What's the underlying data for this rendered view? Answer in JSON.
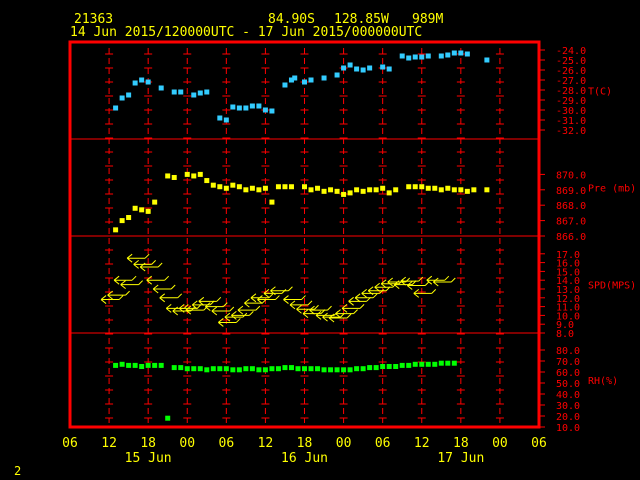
{
  "header": {
    "station": "21363",
    "lat": "84.90S",
    "lon": "128.85W",
    "elev": "989M",
    "time_range": "14 Jun 2015/120000UTC - 17 Jun 2015/000000UTC"
  },
  "page_number": "2",
  "colors": {
    "frame": "#ff0000",
    "text": "#ffff00",
    "temp": "#33ccff",
    "pressure": "#ffff00",
    "wind": "#ffff00",
    "rh": "#00ff00",
    "grid": "#ff0000"
  },
  "chart_data": {
    "type": "scatter",
    "x_ticks": [
      "06",
      "12",
      "18",
      "00",
      "06",
      "12",
      "18",
      "00",
      "06",
      "12",
      "18",
      "00",
      "06"
    ],
    "date_labels": [
      {
        "label": "15 Jun",
        "at_hour": 18
      },
      {
        "label": "16 Jun",
        "at_hour": 42
      },
      {
        "label": "17 Jun",
        "at_hour": 66
      }
    ],
    "xlim_hours_from_14jun_00utc": [
      6,
      78
    ],
    "panels": [
      {
        "name": "temperature",
        "label": "T(C)",
        "ylim": [
          -32,
          -24
        ],
        "tick_labels": [
          "-24.0",
          "-25.0",
          "-26.0",
          "-27.0",
          "-28.0",
          "-29.0",
          "-30.0",
          "-31.0",
          "-32.0"
        ],
        "tick_values": [
          -24,
          -25,
          -26,
          -27,
          -28,
          -29,
          -30,
          -31,
          -32
        ],
        "points": [
          [
            13,
            -29.8
          ],
          [
            14,
            -28.8
          ],
          [
            15,
            -28.5
          ],
          [
            16,
            -27.3
          ],
          [
            17,
            -27.0
          ],
          [
            18,
            -27.2
          ],
          [
            20,
            -27.8
          ],
          [
            22,
            -28.2
          ],
          [
            23,
            -28.2
          ],
          [
            25,
            -28.5
          ],
          [
            26,
            -28.3
          ],
          [
            27,
            -28.2
          ],
          [
            29,
            -30.8
          ],
          [
            30,
            -31.0
          ],
          [
            31,
            -29.7
          ],
          [
            32,
            -29.8
          ],
          [
            33,
            -29.8
          ],
          [
            34,
            -29.6
          ],
          [
            35,
            -29.6
          ],
          [
            36,
            -30.0
          ],
          [
            37,
            -30.1
          ],
          [
            39,
            -27.5
          ],
          [
            40,
            -27.0
          ],
          [
            40.5,
            -26.8
          ],
          [
            42,
            -27.2
          ],
          [
            43,
            -27.0
          ],
          [
            45,
            -26.8
          ],
          [
            47,
            -26.5
          ],
          [
            48,
            -25.8
          ],
          [
            49,
            -25.5
          ],
          [
            50,
            -25.9
          ],
          [
            51,
            -26.0
          ],
          [
            52,
            -25.8
          ],
          [
            54,
            -25.7
          ],
          [
            55,
            -25.9
          ],
          [
            57,
            -24.6
          ],
          [
            58,
            -24.8
          ],
          [
            59,
            -24.7
          ],
          [
            60,
            -24.7
          ],
          [
            61,
            -24.6
          ],
          [
            63,
            -24.6
          ],
          [
            64,
            -24.5
          ],
          [
            65,
            -24.3
          ],
          [
            66,
            -24.3
          ],
          [
            67,
            -24.4
          ],
          [
            70,
            -25.0
          ]
        ]
      },
      {
        "name": "pressure",
        "label": "Pre (mb)",
        "ylim": [
          866,
          871
        ],
        "tick_labels": [
          "866.0",
          "867.0",
          "868.0",
          "869.0",
          "870.0"
        ],
        "tick_values": [
          866,
          867,
          868,
          869,
          870
        ],
        "points": [
          [
            13,
            866.4
          ],
          [
            14,
            867.0
          ],
          [
            15,
            867.2
          ],
          [
            16,
            867.8
          ],
          [
            17,
            867.7
          ],
          [
            18,
            867.6
          ],
          [
            19,
            868.2
          ],
          [
            21,
            869.9
          ],
          [
            22,
            869.8
          ],
          [
            24,
            870.0
          ],
          [
            25,
            869.9
          ],
          [
            26,
            870.0
          ],
          [
            27,
            869.6
          ],
          [
            28,
            869.3
          ],
          [
            29,
            869.2
          ],
          [
            30,
            869.1
          ],
          [
            31,
            869.3
          ],
          [
            32,
            869.2
          ],
          [
            33,
            869.0
          ],
          [
            34,
            869.1
          ],
          [
            35,
            869.0
          ],
          [
            36,
            869.1
          ],
          [
            37,
            868.2
          ],
          [
            38,
            869.2
          ],
          [
            39,
            869.2
          ],
          [
            40,
            869.2
          ],
          [
            42,
            869.2
          ],
          [
            43,
            869.0
          ],
          [
            44,
            869.1
          ],
          [
            45,
            868.9
          ],
          [
            46,
            869.0
          ],
          [
            47,
            868.9
          ],
          [
            48,
            868.7
          ],
          [
            49,
            868.8
          ],
          [
            50,
            869.0
          ],
          [
            51,
            868.9
          ],
          [
            52,
            869.0
          ],
          [
            53,
            869.0
          ],
          [
            54,
            869.1
          ],
          [
            55,
            868.8
          ],
          [
            56,
            869.0
          ],
          [
            58,
            869.2
          ],
          [
            59,
            869.2
          ],
          [
            60,
            869.2
          ],
          [
            61,
            869.1
          ],
          [
            62,
            869.1
          ],
          [
            63,
            869.0
          ],
          [
            64,
            869.1
          ],
          [
            65,
            869.0
          ],
          [
            66,
            869.0
          ],
          [
            67,
            868.9
          ],
          [
            68,
            869.0
          ],
          [
            70,
            869.0
          ]
        ]
      },
      {
        "name": "wind_speed",
        "label": "SPD(MPS)",
        "ylim": [
          8,
          18
        ],
        "tick_labels": [
          "8.0",
          "9.0",
          "10.0",
          "11.0",
          "12.0",
          "13.0",
          "14.0",
          "15.0",
          "16.0",
          "17.0"
        ],
        "tick_values": [
          8,
          9,
          10,
          11,
          12,
          13,
          14,
          15,
          16,
          17
        ],
        "points": [
          [
            12,
            11.8
          ],
          [
            13,
            12.3
          ],
          [
            14,
            14.0
          ],
          [
            15,
            13.5
          ],
          [
            16,
            16.5
          ],
          [
            17,
            15.8
          ],
          [
            18,
            15.5
          ],
          [
            19,
            14.0
          ],
          [
            20,
            13.0
          ],
          [
            21,
            12.0
          ],
          [
            22,
            10.8
          ],
          [
            23,
            10.5
          ],
          [
            24,
            10.8
          ],
          [
            25,
            10.6
          ],
          [
            26,
            11.2
          ],
          [
            27,
            11.6
          ],
          [
            28,
            11.0
          ],
          [
            29,
            10.5
          ],
          [
            30,
            9.2
          ],
          [
            31,
            9.8
          ],
          [
            32,
            10.0
          ],
          [
            33,
            10.6
          ],
          [
            34,
            11.4
          ],
          [
            35,
            12.0
          ],
          [
            36,
            11.8
          ],
          [
            37,
            12.5
          ],
          [
            38,
            12.8
          ],
          [
            40,
            11.8
          ],
          [
            41,
            11.2
          ],
          [
            42,
            10.7
          ],
          [
            43,
            10.2
          ],
          [
            44,
            10.6
          ],
          [
            45,
            10.0
          ],
          [
            46,
            9.8
          ],
          [
            47,
            9.7
          ],
          [
            48,
            10.2
          ],
          [
            49,
            10.8
          ],
          [
            50,
            11.6
          ],
          [
            51,
            12.0
          ],
          [
            52,
            12.5
          ],
          [
            53,
            12.8
          ],
          [
            54,
            13.2
          ],
          [
            55,
            13.6
          ],
          [
            56,
            13.8
          ],
          [
            57,
            13.5
          ],
          [
            58,
            13.9
          ],
          [
            59,
            13.4
          ],
          [
            60,
            12.5
          ],
          [
            62,
            14.0
          ],
          [
            63,
            13.8
          ]
        ]
      },
      {
        "name": "relative_humidity",
        "label": "RH(%)",
        "ylim": [
          10,
          80
        ],
        "tick_labels": [
          "10.0",
          "20.0",
          "30.0",
          "40.0",
          "50.0",
          "60.0",
          "70.0",
          "80.0"
        ],
        "tick_values": [
          10,
          20,
          30,
          40,
          50,
          60,
          70,
          80
        ],
        "points": [
          [
            13,
            66
          ],
          [
            14,
            67
          ],
          [
            15,
            66
          ],
          [
            16,
            66
          ],
          [
            17,
            65
          ],
          [
            18,
            66
          ],
          [
            19,
            66
          ],
          [
            20,
            66
          ],
          [
            21,
            18
          ],
          [
            22,
            64
          ],
          [
            23,
            64
          ],
          [
            24,
            63
          ],
          [
            25,
            63
          ],
          [
            26,
            63
          ],
          [
            27,
            62
          ],
          [
            28,
            63
          ],
          [
            29,
            63
          ],
          [
            30,
            63
          ],
          [
            31,
            62
          ],
          [
            32,
            62
          ],
          [
            33,
            63
          ],
          [
            34,
            63
          ],
          [
            35,
            62
          ],
          [
            36,
            62
          ],
          [
            37,
            63
          ],
          [
            38,
            63
          ],
          [
            39,
            64
          ],
          [
            40,
            64
          ],
          [
            41,
            63
          ],
          [
            42,
            63
          ],
          [
            43,
            63
          ],
          [
            44,
            63
          ],
          [
            45,
            62
          ],
          [
            46,
            62
          ],
          [
            47,
            62
          ],
          [
            48,
            62
          ],
          [
            49,
            62
          ],
          [
            50,
            63
          ],
          [
            51,
            63
          ],
          [
            52,
            64
          ],
          [
            53,
            64
          ],
          [
            54,
            65
          ],
          [
            55,
            65
          ],
          [
            56,
            65
          ],
          [
            57,
            66
          ],
          [
            58,
            66
          ],
          [
            59,
            67
          ],
          [
            60,
            67
          ],
          [
            61,
            67
          ],
          [
            62,
            67
          ],
          [
            63,
            68
          ],
          [
            64,
            68
          ],
          [
            65,
            68
          ]
        ]
      }
    ]
  }
}
